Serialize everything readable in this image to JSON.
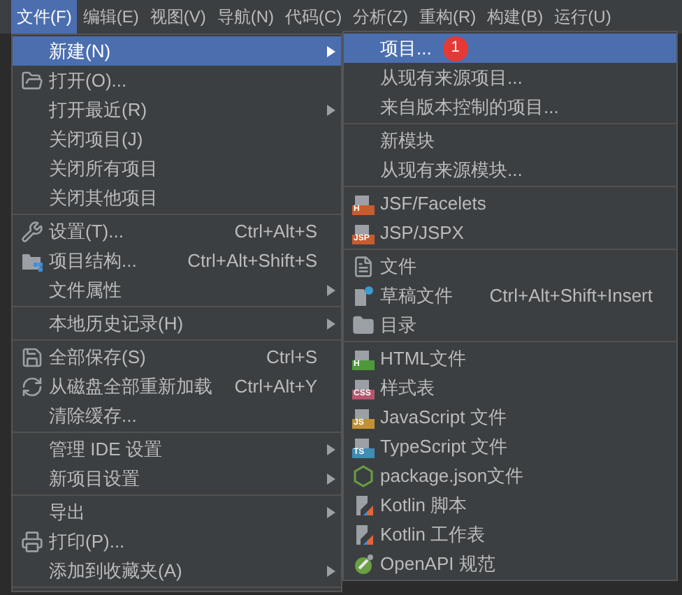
{
  "menu_bar": [
    {
      "label": "文件(F)",
      "selected": true
    },
    {
      "label": "编辑(E)",
      "selected": false
    },
    {
      "label": "视图(V)",
      "selected": false
    },
    {
      "label": "导航(N)",
      "selected": false
    },
    {
      "label": "代码(C)",
      "selected": false
    },
    {
      "label": "分析(Z)",
      "selected": false
    },
    {
      "label": "重构(R)",
      "selected": false
    },
    {
      "label": "构建(B)",
      "selected": false
    },
    {
      "label": "运行(U)",
      "selected": false
    }
  ],
  "file_menu": [
    {
      "kind": "plain",
      "label": "新建(N)",
      "submenu": true,
      "selected": true
    },
    {
      "kind": "open",
      "label": "打开(O)...",
      "selected": false
    },
    {
      "kind": "plain",
      "label": "打开最近(R)",
      "submenu": true,
      "selected": false
    },
    {
      "kind": "plain",
      "label": "关闭项目(J)",
      "selected": false
    },
    {
      "kind": "plain",
      "label": "关闭所有项目",
      "selected": false
    },
    {
      "kind": "plain",
      "label": "关闭其他项目",
      "selected": false
    },
    {
      "kind": "separator"
    },
    {
      "kind": "wrench",
      "label": "设置(T)...",
      "shortcut": "Ctrl+Alt+S",
      "selected": false
    },
    {
      "kind": "structure",
      "label": "项目结构...",
      "shortcut": "Ctrl+Alt+Shift+S",
      "selected": false
    },
    {
      "kind": "plain",
      "label": "文件属性",
      "submenu": true,
      "selected": false
    },
    {
      "kind": "separator"
    },
    {
      "kind": "plain",
      "label": "本地历史记录(H)",
      "submenu": true,
      "selected": false
    },
    {
      "kind": "separator"
    },
    {
      "kind": "save",
      "label": "全部保存(S)",
      "shortcut": "Ctrl+S",
      "selected": false
    },
    {
      "kind": "reload",
      "label": "从磁盘全部重新加载",
      "shortcut": "Ctrl+Alt+Y",
      "selected": false
    },
    {
      "kind": "plain",
      "label": "清除缓存...",
      "selected": false
    },
    {
      "kind": "separator"
    },
    {
      "kind": "plain",
      "label": "管理 IDE 设置",
      "submenu": true,
      "selected": false
    },
    {
      "kind": "plain",
      "label": "新项目设置",
      "submenu": true,
      "selected": false
    },
    {
      "kind": "separator"
    },
    {
      "kind": "plain",
      "label": "导出",
      "submenu": true,
      "selected": false
    },
    {
      "kind": "printer",
      "label": "打印(P)...",
      "selected": false
    },
    {
      "kind": "plain",
      "label": "添加到收藏夹(A)",
      "submenu": true,
      "selected": false
    },
    {
      "kind": "separator"
    }
  ],
  "new_submenu": [
    {
      "kind": "plain",
      "label": "项目...",
      "badge": "1",
      "selected": true
    },
    {
      "kind": "plain",
      "label": "从现有来源项目...",
      "selected": false
    },
    {
      "kind": "plain",
      "label": "来自版本控制的项目...",
      "selected": false
    },
    {
      "kind": "separator"
    },
    {
      "kind": "plain",
      "label": "新模块",
      "selected": false
    },
    {
      "kind": "plain",
      "label": "从现有来源模块...",
      "selected": false
    },
    {
      "kind": "separator"
    },
    {
      "kind": "tagged",
      "label": "JSF/Facelets",
      "icon_text": "H",
      "color": "#c75c2e",
      "selected": false
    },
    {
      "kind": "tagged",
      "label": "JSP/JSPX",
      "icon_text": "JSP",
      "color": "#c75c2e",
      "selected": false
    },
    {
      "kind": "separator"
    },
    {
      "kind": "file",
      "label": "文件",
      "selected": false
    },
    {
      "kind": "scratch",
      "label": "草稿文件",
      "shortcut": "Ctrl+Alt+Shift+Insert",
      "selected": false
    },
    {
      "kind": "folder",
      "label": "目录",
      "selected": false
    },
    {
      "kind": "separator"
    },
    {
      "kind": "tagged",
      "label": "HTML文件",
      "icon_text": "H",
      "color": "#4e9a3a",
      "selected": false
    },
    {
      "kind": "tagged",
      "label": "样式表",
      "icon_text": "CSS",
      "color": "#b5566d",
      "selected": false
    },
    {
      "kind": "tagged",
      "label": "JavaScript 文件",
      "icon_text": "JS",
      "color": "#c29232",
      "selected": false
    },
    {
      "kind": "tagged",
      "label": "TypeScript 文件",
      "icon_text": "TS",
      "color": "#3d8db5",
      "selected": false
    },
    {
      "kind": "node",
      "label": "package.json文件",
      "selected": false
    },
    {
      "kind": "kotlin",
      "label": "Kotlin 脚本",
      "selected": false
    },
    {
      "kind": "kotlin",
      "label": "Kotlin 工作表",
      "selected": false
    },
    {
      "kind": "openapi",
      "label": "OpenAPI 规范",
      "selected": false
    }
  ]
}
